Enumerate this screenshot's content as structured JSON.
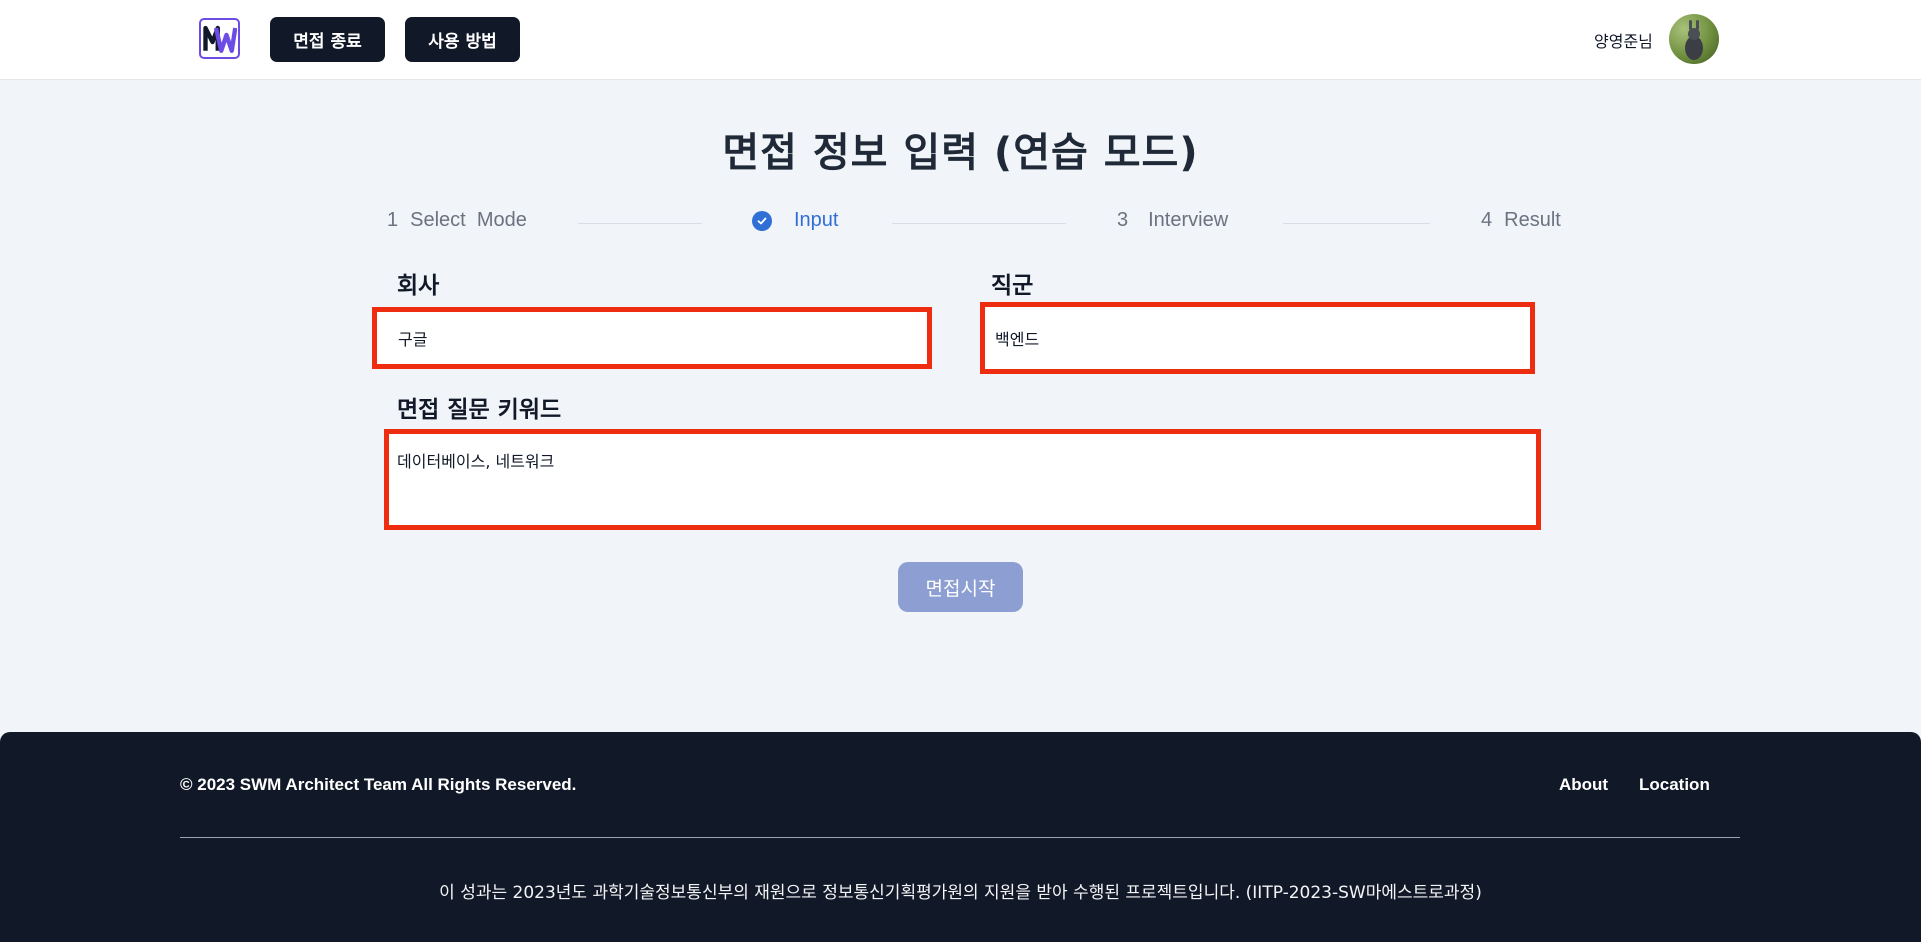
{
  "header": {
    "logo_text": "MW",
    "end_interview_label": "면접 종료",
    "how_to_use_label": "사용 방법",
    "user_name": "양영준님"
  },
  "main": {
    "title": "면접 정보 입력 (연습 모드)",
    "steps": [
      {
        "num": "1",
        "label": "Select  Mode",
        "state": "pending"
      },
      {
        "num": "",
        "label": "Input",
        "state": "active"
      },
      {
        "num": "3",
        "label": "Interview",
        "state": "pending"
      },
      {
        "num": "4",
        "label": "Result",
        "state": "pending"
      }
    ],
    "company": {
      "label": "회사",
      "value": "구글"
    },
    "position": {
      "label": "직군",
      "value": "백엔드"
    },
    "keywords": {
      "label": "면접 질문 키워드",
      "value": "데이터베이스, 네트워크"
    },
    "start_button_label": "면접시작"
  },
  "footer": {
    "copyright": "© 2023 SWM Architect Team All Rights Reserved.",
    "links": [
      "About",
      "Location"
    ],
    "credit": "이 성과는 2023년도 과학기술정보통신부의 재원으로 정보통신기획평가원의 지원을 받아 수행된 프로젝트입니다. (IITP-2023-SW마에스트로과정)"
  },
  "colors": {
    "accent": "#2f6fd6",
    "highlight_border": "#ee2c10",
    "dark": "#111827",
    "button_disabled": "#8d9fd2"
  }
}
